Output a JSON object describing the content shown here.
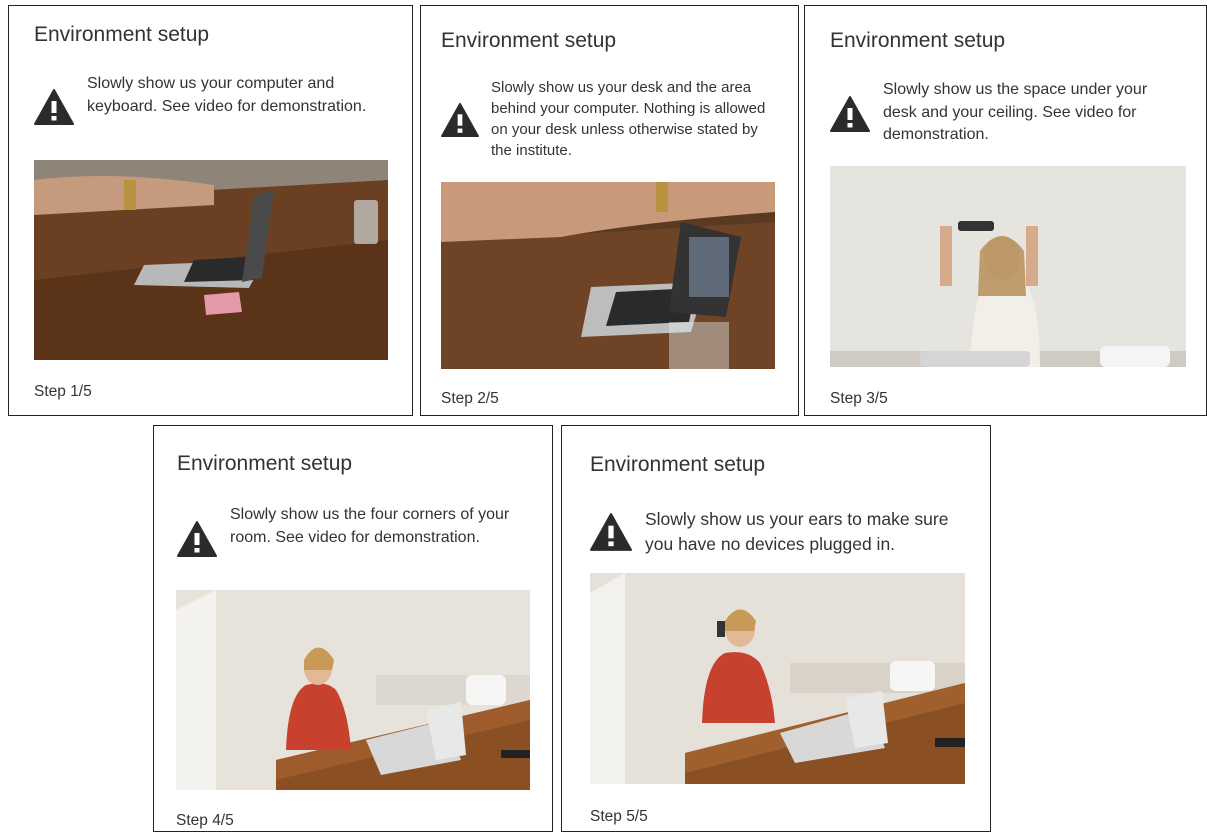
{
  "cards": [
    {
      "title": "Environment setup",
      "instruction": "Slowly show us your computer and keyboard. See video for demonstration.",
      "step": "Step 1/5",
      "video_scene": "hands-over-laptop-on-wood-table",
      "icon": "warning-triangle-icon"
    },
    {
      "title": "Environment setup",
      "instruction": "Slowly show us your desk and the area behind your computer. Nothing is allowed on your desk unless otherwise stated by the institute.",
      "step": "Step 2/5",
      "video_scene": "arm-over-laptop-with-glass",
      "icon": "warning-triangle-icon"
    },
    {
      "title": "Environment setup",
      "instruction": "Slowly show us the space under your desk and your ceiling. See video for demonstration.",
      "step": "Step 3/5",
      "video_scene": "woman-holding-laptop-up-to-ceiling",
      "icon": "warning-triangle-icon"
    },
    {
      "title": "Environment setup",
      "instruction": "Slowly show us the four corners of your room. See video for demonstration.",
      "step": "Step 4/5",
      "video_scene": "woman-in-red-at-table-with-laptop",
      "icon": "warning-triangle-icon"
    },
    {
      "title": "Environment setup",
      "instruction": "Slowly show us your ears to make sure you have no devices plugged in.",
      "step": "Step 5/5",
      "video_scene": "woman-in-red-showing-ear",
      "icon": "warning-triangle-icon"
    }
  ],
  "colors": {
    "border": "#222222",
    "text": "#333333",
    "icon": "#2b2b2b",
    "wood": "#6b3f22",
    "wall": "#e9e4dc",
    "dress": "#c8402e"
  }
}
